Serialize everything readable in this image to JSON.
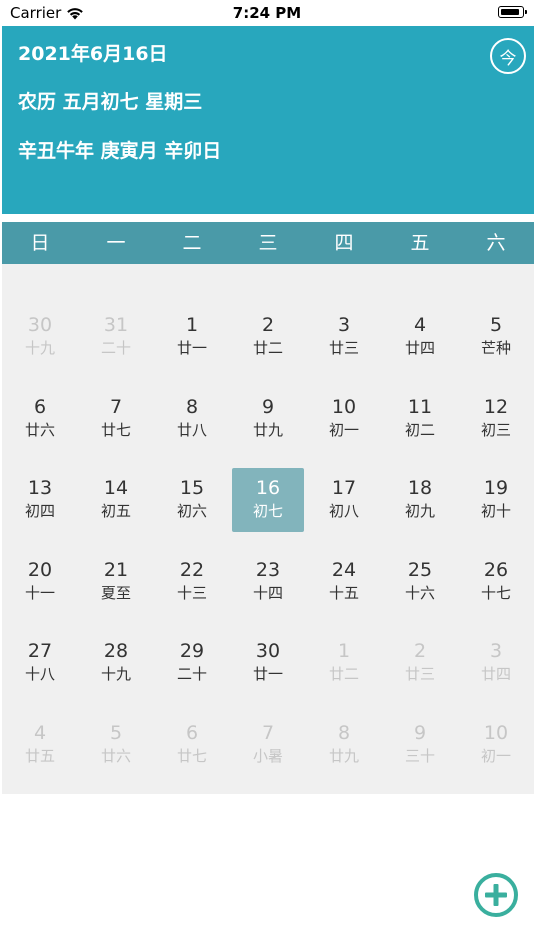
{
  "status_bar": {
    "carrier": "Carrier",
    "time": "7:24 PM"
  },
  "header": {
    "date": "2021年6月16日",
    "lunar": "农历 五月初七 星期三",
    "ganzhi": "辛丑牛年 庚寅月 辛卯日",
    "today_button": "今"
  },
  "week_days": [
    "日",
    "一",
    "二",
    "三",
    "四",
    "五",
    "六"
  ],
  "calendar": {
    "selected_day": 16,
    "weeks": [
      [
        {
          "day": "30",
          "lunar": "十九",
          "other": true
        },
        {
          "day": "31",
          "lunar": "二十",
          "other": true
        },
        {
          "day": "1",
          "lunar": "廿一",
          "other": false
        },
        {
          "day": "2",
          "lunar": "廿二",
          "other": false
        },
        {
          "day": "3",
          "lunar": "廿三",
          "other": false
        },
        {
          "day": "4",
          "lunar": "廿四",
          "other": false
        },
        {
          "day": "5",
          "lunar": "芒种",
          "other": false
        }
      ],
      [
        {
          "day": "6",
          "lunar": "廿六",
          "other": false
        },
        {
          "day": "7",
          "lunar": "廿七",
          "other": false
        },
        {
          "day": "8",
          "lunar": "廿八",
          "other": false
        },
        {
          "day": "9",
          "lunar": "廿九",
          "other": false
        },
        {
          "day": "10",
          "lunar": "初一",
          "other": false
        },
        {
          "day": "11",
          "lunar": "初二",
          "other": false
        },
        {
          "day": "12",
          "lunar": "初三",
          "other": false
        }
      ],
      [
        {
          "day": "13",
          "lunar": "初四",
          "other": false
        },
        {
          "day": "14",
          "lunar": "初五",
          "other": false
        },
        {
          "day": "15",
          "lunar": "初六",
          "other": false
        },
        {
          "day": "16",
          "lunar": "初七",
          "other": false
        },
        {
          "day": "17",
          "lunar": "初八",
          "other": false
        },
        {
          "day": "18",
          "lunar": "初九",
          "other": false
        },
        {
          "day": "19",
          "lunar": "初十",
          "other": false
        }
      ],
      [
        {
          "day": "20",
          "lunar": "十一",
          "other": false
        },
        {
          "day": "21",
          "lunar": "夏至",
          "other": false
        },
        {
          "day": "22",
          "lunar": "十三",
          "other": false
        },
        {
          "day": "23",
          "lunar": "十四",
          "other": false
        },
        {
          "day": "24",
          "lunar": "十五",
          "other": false
        },
        {
          "day": "25",
          "lunar": "十六",
          "other": false
        },
        {
          "day": "26",
          "lunar": "十七",
          "other": false
        }
      ],
      [
        {
          "day": "27",
          "lunar": "十八",
          "other": false
        },
        {
          "day": "28",
          "lunar": "十九",
          "other": false
        },
        {
          "day": "29",
          "lunar": "二十",
          "other": false
        },
        {
          "day": "30",
          "lunar": "廿一",
          "other": false
        },
        {
          "day": "1",
          "lunar": "廿二",
          "other": true
        },
        {
          "day": "2",
          "lunar": "廿三",
          "other": true
        },
        {
          "day": "3",
          "lunar": "廿四",
          "other": true
        }
      ],
      [
        {
          "day": "4",
          "lunar": "廿五",
          "other": true
        },
        {
          "day": "5",
          "lunar": "廿六",
          "other": true
        },
        {
          "day": "6",
          "lunar": "廿七",
          "other": true
        },
        {
          "day": "7",
          "lunar": "小暑",
          "other": true
        },
        {
          "day": "8",
          "lunar": "廿九",
          "other": true
        },
        {
          "day": "9",
          "lunar": "三十",
          "other": true
        },
        {
          "day": "10",
          "lunar": "初一",
          "other": true
        }
      ]
    ]
  },
  "colors": {
    "header_bg": "#28a7bd",
    "week_header_bg": "#4a9aa8",
    "selected_bg": "#82b4bc",
    "grid_bg": "#f0f0f0",
    "add_button": "#3aaf9e"
  },
  "icons": {
    "wifi": "wifi-icon",
    "battery": "battery-icon",
    "add": "plus-circle-icon"
  }
}
